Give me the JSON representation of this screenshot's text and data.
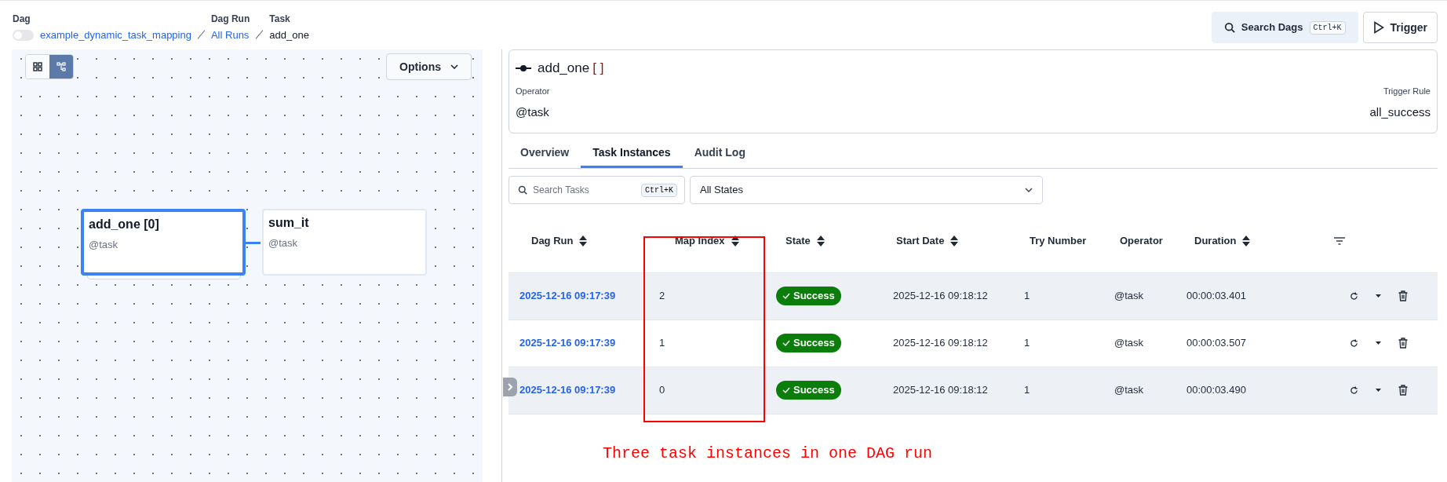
{
  "breadcrumbs": [
    {
      "kind": "toggle",
      "label": "Dag",
      "value": "example_dynamic_task_mapping",
      "on": false
    },
    {
      "kind": "link",
      "label": "Dag Run",
      "value": "All Runs"
    },
    {
      "kind": "text",
      "label": "Task",
      "value": "add_one"
    }
  ],
  "search_button": {
    "label": "Search Dags",
    "shortcut": "Ctrl+K"
  },
  "trigger_button": {
    "label": "Trigger"
  },
  "graph": {
    "views": [
      {
        "kind": "grid",
        "selected": false
      },
      {
        "kind": "graph",
        "selected": true
      }
    ],
    "options_label": "Options",
    "nodes": [
      {
        "title": "add_one [0]",
        "subtitle": "@task",
        "selected": true,
        "mapped": true
      },
      {
        "title": "sum_it",
        "subtitle": "@task",
        "selected": false,
        "mapped": false
      }
    ]
  },
  "task_header": {
    "name": "add_one",
    "map_marker": "[ ]",
    "fields": [
      {
        "label": "Operator",
        "value": "@task"
      },
      {
        "label": "Trigger Rule",
        "value": "all_success"
      }
    ]
  },
  "tabs": [
    {
      "label": "Overview",
      "selected": false
    },
    {
      "label": "Task Instances",
      "selected": true
    },
    {
      "label": "Audit Log",
      "selected": false
    }
  ],
  "filters": {
    "search_placeholder": "Search Tasks",
    "shortcut": "Ctrl+K",
    "state_value": "All States"
  },
  "table": {
    "columns": [
      {
        "label": "Dag Run",
        "sortable": true
      },
      {
        "label": "Map Index",
        "sortable": true
      },
      {
        "label": "State",
        "sortable": true
      },
      {
        "label": "Start Date",
        "sortable": true
      },
      {
        "label": "Try Number",
        "sortable": false
      },
      {
        "label": "Operator",
        "sortable": false
      },
      {
        "label": "Duration",
        "sortable": true
      }
    ],
    "rows": [
      {
        "dag_run": "2025-12-16 09:17:39",
        "map_index": "2",
        "state": "Success",
        "start_date": "2025-12-16 09:18:12",
        "try_number": "1",
        "operator": "@task",
        "duration": "00:00:03.401"
      },
      {
        "dag_run": "2025-12-16 09:17:39",
        "map_index": "1",
        "state": "Success",
        "start_date": "2025-12-16 09:18:12",
        "try_number": "1",
        "operator": "@task",
        "duration": "00:00:03.507"
      },
      {
        "dag_run": "2025-12-16 09:17:39",
        "map_index": "0",
        "state": "Success",
        "start_date": "2025-12-16 09:18:12",
        "try_number": "1",
        "operator": "@task",
        "duration": "00:00:03.490"
      }
    ]
  },
  "annotation": {
    "text": "Three task instances in one DAG run"
  }
}
